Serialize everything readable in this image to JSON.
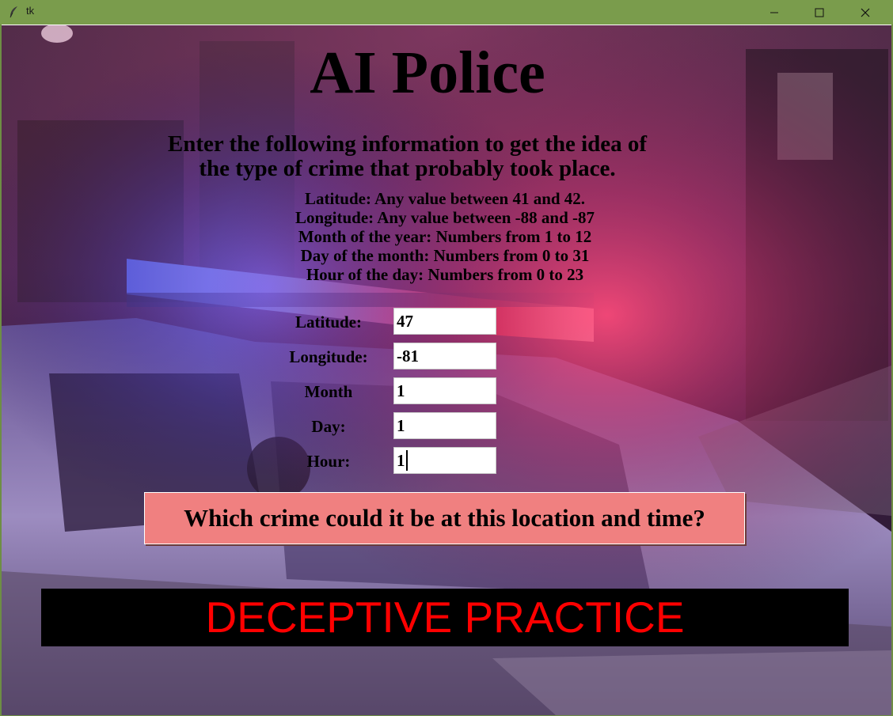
{
  "window": {
    "title": "tk",
    "icons": {
      "app": "feather-icon",
      "minimize": "minimize-icon",
      "maximize": "maximize-icon",
      "close": "close-icon"
    }
  },
  "app": {
    "title": "AI Police",
    "subtitle_line1": "Enter the following information to get the idea of",
    "subtitle_line2": "the type of crime that probably took place.",
    "info": [
      "Latitude: Any value between 41 and 42.",
      "Longitude: Any value between -88 and -87",
      "Month of the year: Numbers from 1 to 12",
      "Day of the month: Numbers from 0 to 31",
      "Hour of the day: Numbers from 0 to 23"
    ],
    "form": {
      "latitude_label": "Latitude:",
      "latitude_value": "47",
      "longitude_label": "Longitude:",
      "longitude_value": "-81",
      "month_label": "Month",
      "month_value": "1",
      "day_label": "Day:",
      "day_value": "1",
      "hour_label": "Hour:",
      "hour_value": "1"
    },
    "predict_button": "Which crime could it be at this location and time?",
    "result": "DECEPTIVE PRACTICE",
    "colors": {
      "button_bg": "#f08080",
      "result_bg": "#000000",
      "result_text": "#ff0000",
      "titlebar": "#7a9c4c"
    }
  }
}
